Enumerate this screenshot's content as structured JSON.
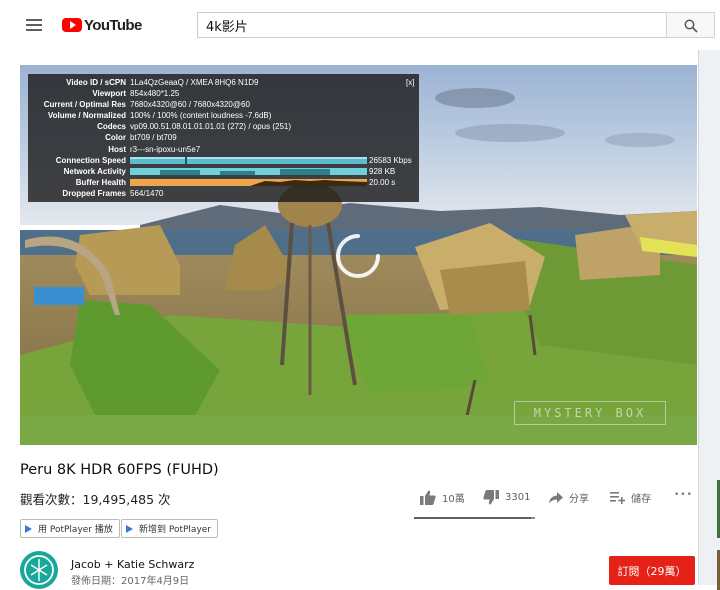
{
  "header": {
    "logo_text": "YouTube",
    "search_value": "4k影片"
  },
  "player": {
    "close_label": "[x]",
    "watermark": "MYSTERY BOX",
    "stats": [
      {
        "label": "Video ID / sCPN",
        "value": "1La4QzGeaaQ / XMEA 8HQ6 N1D9"
      },
      {
        "label": "Viewport",
        "value": "854x480*1.25"
      },
      {
        "label": "Current / Optimal Res",
        "value": "7680x4320@60 / 7680x4320@60"
      },
      {
        "label": "Volume / Normalized",
        "value": "100% / 100% (content loudness -7.6dB)"
      },
      {
        "label": "Codecs",
        "value": "vp09.00.51.08.01.01.01.01 (272) / opus (251)"
      },
      {
        "label": "Color",
        "value": "bt709 / bt709"
      },
      {
        "label": "Host",
        "value": "r3---sn-ipoxu-un5e7"
      },
      {
        "label": "Connection Speed",
        "value": "26583 Kbps"
      },
      {
        "label": "Network Activity",
        "value": "928 KB"
      },
      {
        "label": "Buffer Health",
        "value": "20.00 s"
      },
      {
        "label": "Dropped Frames",
        "value": "564/1470"
      }
    ],
    "colors": {
      "connection": "#5bbcd0",
      "network": "#6fd0d9",
      "buffer": "#efa54c"
    }
  },
  "video": {
    "title": "Peru 8K HDR 60FPS (FUHD)",
    "views": "觀看次數：19,495,485 次",
    "likes": "10萬",
    "dislikes": "3301",
    "like_ratio": 0.97,
    "share_label": "分享",
    "save_label": "儲存",
    "more_label": "•••"
  },
  "potplayer": {
    "play_label": "用 PotPlayer 播放",
    "add_label": "新增到 PotPlayer"
  },
  "channel": {
    "name": "Jacob + Katie Schwarz",
    "published": "發佈日期：2017年4月9日",
    "subscribe_label": "訂閱（29萬）"
  },
  "colors": {
    "accent": "#ff0000",
    "subscribe": "#e62117",
    "avatar": "#16a99a"
  }
}
